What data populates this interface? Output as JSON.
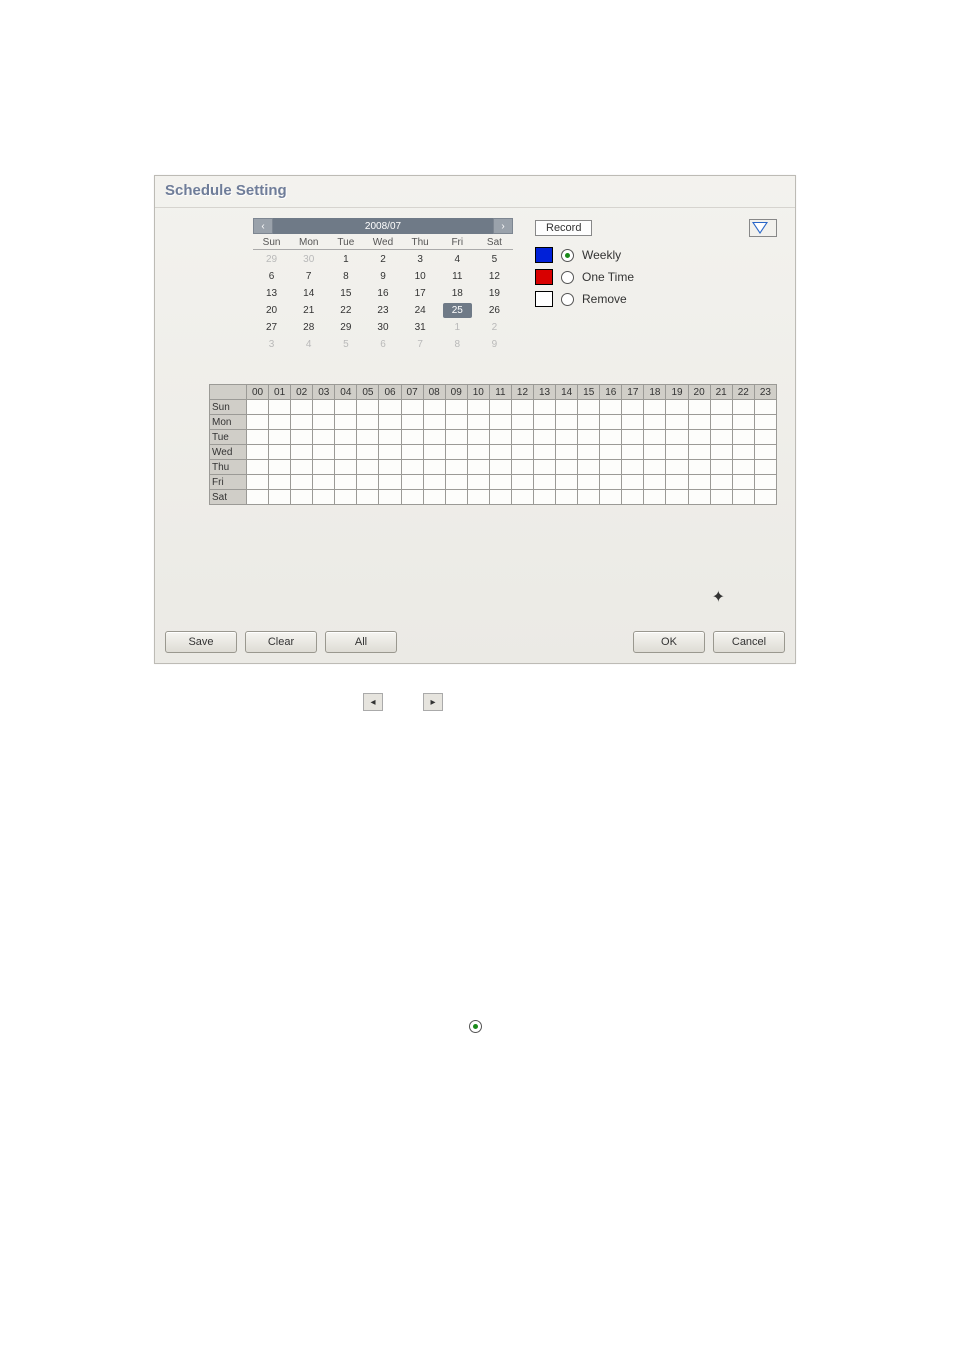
{
  "title": "Schedule Setting",
  "calendar": {
    "month_label": "2008/07",
    "day_headers": [
      "Sun",
      "Mon",
      "Tue",
      "Wed",
      "Thu",
      "Fri",
      "Sat"
    ],
    "rows": [
      [
        {
          "v": "29",
          "m": true
        },
        {
          "v": "30",
          "m": true
        },
        {
          "v": "1"
        },
        {
          "v": "2"
        },
        {
          "v": "3"
        },
        {
          "v": "4"
        },
        {
          "v": "5"
        }
      ],
      [
        {
          "v": "6"
        },
        {
          "v": "7"
        },
        {
          "v": "8"
        },
        {
          "v": "9"
        },
        {
          "v": "10"
        },
        {
          "v": "11"
        },
        {
          "v": "12"
        }
      ],
      [
        {
          "v": "13"
        },
        {
          "v": "14"
        },
        {
          "v": "15"
        },
        {
          "v": "16"
        },
        {
          "v": "17"
        },
        {
          "v": "18"
        },
        {
          "v": "19"
        }
      ],
      [
        {
          "v": "20"
        },
        {
          "v": "21"
        },
        {
          "v": "22"
        },
        {
          "v": "23"
        },
        {
          "v": "24"
        },
        {
          "v": "25",
          "sel": true
        },
        {
          "v": "26"
        }
      ],
      [
        {
          "v": "27"
        },
        {
          "v": "28"
        },
        {
          "v": "29"
        },
        {
          "v": "30"
        },
        {
          "v": "31"
        },
        {
          "v": "1",
          "m": true
        },
        {
          "v": "2",
          "m": true
        }
      ],
      [
        {
          "v": "3",
          "m": true
        },
        {
          "v": "4",
          "m": true
        },
        {
          "v": "5",
          "m": true
        },
        {
          "v": "6",
          "m": true
        },
        {
          "v": "7",
          "m": true
        },
        {
          "v": "8",
          "m": true
        },
        {
          "v": "9",
          "m": true
        }
      ]
    ]
  },
  "record": {
    "label": "Record",
    "options": {
      "weekly": "Weekly",
      "onetime": "One Time",
      "remove": "Remove"
    }
  },
  "hours": [
    "00",
    "01",
    "02",
    "03",
    "04",
    "05",
    "06",
    "07",
    "08",
    "09",
    "10",
    "11",
    "12",
    "13",
    "14",
    "15",
    "16",
    "17",
    "18",
    "19",
    "20",
    "21",
    "22",
    "23"
  ],
  "days": [
    "Sun",
    "Mon",
    "Tue",
    "Wed",
    "Thu",
    "Fri",
    "Sat"
  ],
  "buttons": {
    "save": "Save",
    "clear": "Clear",
    "all": "All",
    "ok": "OK",
    "cancel": "Cancel"
  }
}
